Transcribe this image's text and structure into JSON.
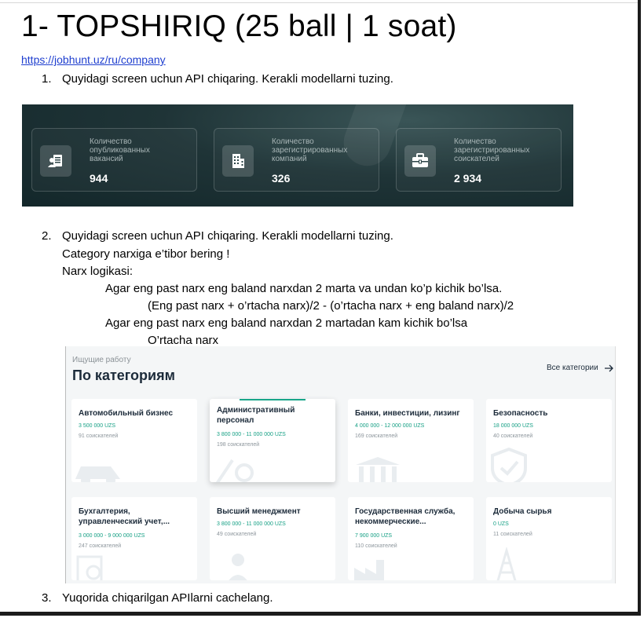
{
  "title": "1- TOPSHIRIQ (25 ball | 1 soat)",
  "link": "https://jobhunt.uz/ru/company",
  "task1": {
    "number": "1.",
    "text": "Quyidagi screen uchun API chiqaring. Kerakli modellarni tuzing."
  },
  "stats": [
    {
      "label": [
        "Количество",
        "опубликованных",
        "вакансий"
      ],
      "value": "944",
      "icon": "user-document-icon"
    },
    {
      "label": [
        "Количество",
        "зарегистрированных",
        "компаний"
      ],
      "value": "326",
      "icon": "building-icon"
    },
    {
      "label": [
        "Количество",
        "зарегистрированных",
        "соискателей"
      ],
      "value": "2 934",
      "icon": "briefcase-icon"
    }
  ],
  "task2": {
    "number": "2.",
    "line1": "Quyidagi screen uchun API chiqaring. Kerakli modellarni tuzing.",
    "line2": "Category narxiga e’tibor bering !",
    "line3": "Narx logikasi:",
    "rule1": "Agar eng past narx eng baland narxdan 2 marta va undan ko’p kichik bo’lsa.",
    "formula1": "(Eng past narx + o’rtacha narx)/2 - (o’rtacha narx + eng baland narx)/2",
    "rule2": "Agar eng past narx eng baland narxdan 2 martadan kam kichik bo’lsa",
    "formula2": "O’rtacha narx"
  },
  "categories": {
    "eyebrow": "Ищущие работу",
    "heading": "По категориям",
    "all_link": "Все категории",
    "items": [
      {
        "title": "Автомобильный бизнес",
        "price": "3 500 000 UZS",
        "count": "91 соискателей"
      },
      {
        "title": "Административный персонал",
        "price": "3 800 000 - 11 000 000 UZS",
        "count": "198 соискателей"
      },
      {
        "title": "Банки, инвестиции, лизинг",
        "price": "4 000 000 - 12 000 000 UZS",
        "count": "169 соискателей"
      },
      {
        "title": "Безопасность",
        "price": "18 000 000 UZS",
        "count": "40 соискателей"
      },
      {
        "title": "Бухгалтерия, управленческий учет,...",
        "price": "3 000 000 - 9 000 000 UZS",
        "count": "247 соискателей"
      },
      {
        "title": "Высший менеджмент",
        "price": "3 800 000 - 11 000 000 UZS",
        "count": "49 соискателей"
      },
      {
        "title": "Государственная служба, некоммерческие...",
        "price": "7 900 000 UZS",
        "count": "110 соискателей"
      },
      {
        "title": "Добыча сырья",
        "price": "0 UZS",
        "count": "11 соискателей"
      }
    ]
  },
  "task3": {
    "number": "3.",
    "text": "Yuqorida chiqarilgan APIlarni cachelang."
  }
}
